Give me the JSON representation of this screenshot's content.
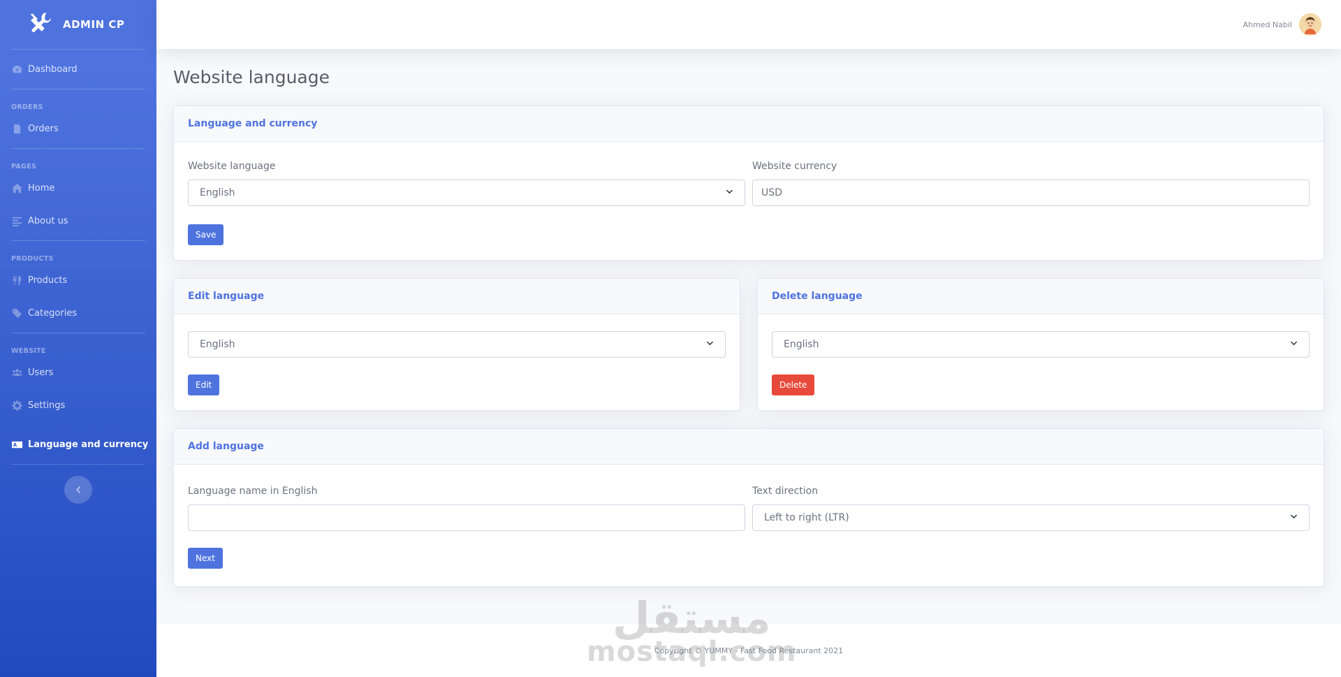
{
  "brand": {
    "title": "ADMIN CP"
  },
  "sidebar": {
    "dashboard": "Dashboard",
    "sections": [
      {
        "heading": "ORDERS",
        "items": [
          "Orders"
        ]
      },
      {
        "heading": "PAGES",
        "items": [
          "Home",
          "About us"
        ]
      },
      {
        "heading": "PRODUCTS",
        "items": [
          "Products",
          "Categories"
        ]
      },
      {
        "heading": "WEBSITE",
        "items": [
          "Users",
          "Settings",
          "Language and currency"
        ]
      }
    ],
    "active_item": "Language and currency"
  },
  "topbar": {
    "user_name": "Ahmed Nabil"
  },
  "page": {
    "title": "Website language"
  },
  "lang_currency_card": {
    "title": "Language and currency",
    "language_label": "Website language",
    "language_value": "English",
    "currency_label": "Website currency",
    "currency_value": "USD",
    "save_label": "Save"
  },
  "edit_card": {
    "title": "Edit language",
    "select_value": "English",
    "button_label": "Edit"
  },
  "delete_card": {
    "title": "Delete language",
    "select_value": "English",
    "button_label": "Delete"
  },
  "add_card": {
    "title": "Add language",
    "name_label": "Language name in English",
    "name_value": "",
    "direction_label": "Text direction",
    "direction_value": "Left to right (LTR)",
    "button_label": "Next"
  },
  "footer": {
    "copyright": "Copyright © YUMMY - Fast Food Restaurant 2021"
  },
  "watermark": {
    "arabic": "مستقل",
    "latin": "mostaql.com"
  },
  "colors": {
    "primary": "#4e73df",
    "danger": "#e74a3b",
    "sidebar_start": "#4e73df",
    "sidebar_end": "#224abe"
  }
}
